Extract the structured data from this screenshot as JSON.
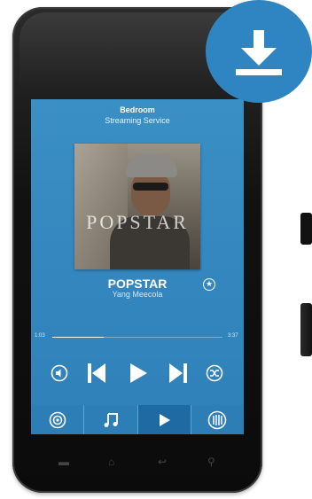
{
  "player": {
    "room": "Bedroom",
    "service": "Streaming Service",
    "album_art_text": "POPSTAR",
    "track_title": "POPSTAR",
    "artist": "Yang Meecola",
    "elapsed": "1:03",
    "total": "3:37",
    "progress": 0.3
  },
  "icons": {
    "download": "download-icon",
    "favorite": "star-icon",
    "volume": "volume-icon",
    "previous": "skip-previous-icon",
    "play": "play-icon",
    "next": "skip-next-icon",
    "shuffle": "shuffle-icon"
  },
  "tabs": [
    {
      "name": "tab-rooms",
      "icon": "speaker-icon"
    },
    {
      "name": "tab-music",
      "icon": "music-note-icon"
    },
    {
      "name": "tab-now-playing",
      "icon": "play-icon",
      "active": true
    },
    {
      "name": "tab-settings",
      "icon": "equalizer-icon"
    }
  ],
  "colors": {
    "screen_blue": "#3a8fc4",
    "tab_blue": "#2d7db6",
    "badge_blue": "#2f85c2"
  }
}
